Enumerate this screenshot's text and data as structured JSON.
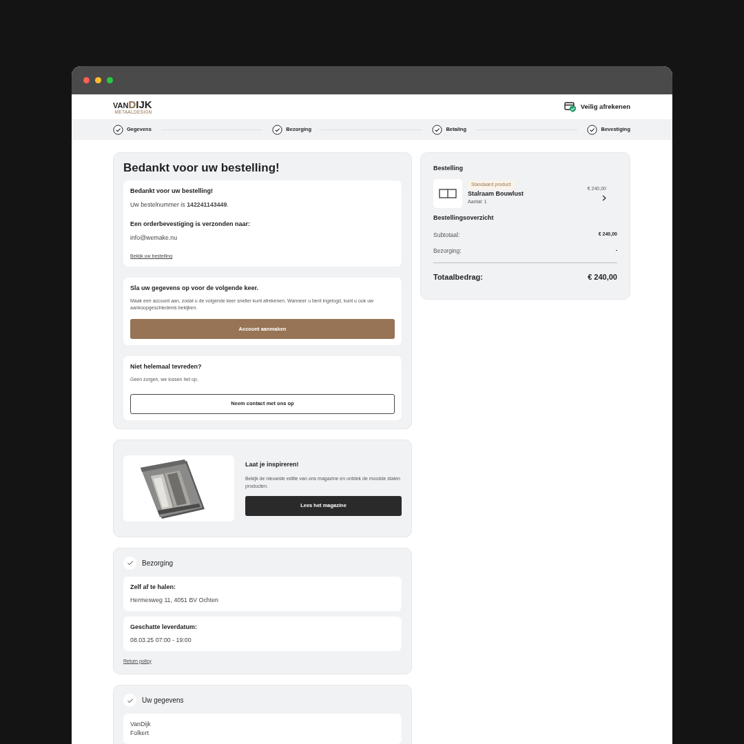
{
  "window": {
    "controls": [
      {
        "color": "#ff5f57"
      },
      {
        "color": "#febc2e"
      },
      {
        "color": "#28c840"
      }
    ]
  },
  "header": {
    "logo": {
      "prefix": "VAN",
      "name": "DIJK",
      "tagline": "METAALDESIGN"
    },
    "secure_label": "Veilig afrekenen"
  },
  "steps": [
    {
      "label": "Gegevens",
      "done": true
    },
    {
      "label": "Bezorging",
      "done": true
    },
    {
      "label": "Betaling",
      "done": true
    },
    {
      "label": "Bevestiging",
      "done": true
    }
  ],
  "confirmation": {
    "title": "Bedankt voor uw bestelling!",
    "thanks": {
      "heading": "Bedankt voor uw bestelling!",
      "order_line": "Uw bestelnummer is **142241143449**.",
      "sent_heading": "Een orderbevestiging is verzonden naar:",
      "email": "info@wemake.nu",
      "link": "Bekijk uw bestelling"
    },
    "account": {
      "heading": "Sla uw gegevens op voor de volgende keer.",
      "text": "Maak een account aan, zodat u de volgende keer sneller kunt afrekenen. Wanneer u bent ingelogd, kunt u ook uw aankoopgeschiedenis bekijken.",
      "button": "Account aanmaken"
    },
    "support": {
      "heading": "Niet helemaal tevreden?",
      "text": "Geen zorgen, we lossen het op.",
      "button": "Neem contact met ons op"
    }
  },
  "magazine": {
    "heading": "Laat je inspireren!",
    "text": "Bekijk de nieuwste editie van ons magazine en ontdek de mooiste stalen producten.",
    "button": "Lees het magazine"
  },
  "delivery": {
    "title": "Bezorging",
    "done": true,
    "blocks": [
      {
        "label": "Zelf af te halen:",
        "value": "Hermesweg 11, 4051 BV Ochten"
      },
      {
        "label": "Geschatte leverdatum:",
        "value": "08.03.25 07:00 - 19:00"
      }
    ],
    "link": "Return policy"
  },
  "details": {
    "title": "Uw gegevens",
    "done": true,
    "lines": [
      "VanDijk",
      "Folkert"
    ]
  },
  "order": {
    "title": "Bestelling",
    "items": [
      {
        "tag": "Standaard product",
        "name": "Stalraam Bouwlust",
        "quantity": "Aantal: 1",
        "price": "€ 240,00"
      }
    ],
    "overview_title": "Bestellingsoverzicht",
    "rows": [
      {
        "label": "Subtotaal:",
        "value": "€ 240,00"
      },
      {
        "label": "Bezorging:",
        "value": "-"
      }
    ],
    "total": {
      "label": "Totaalbedrag:",
      "value": "€ 240,00"
    }
  }
}
